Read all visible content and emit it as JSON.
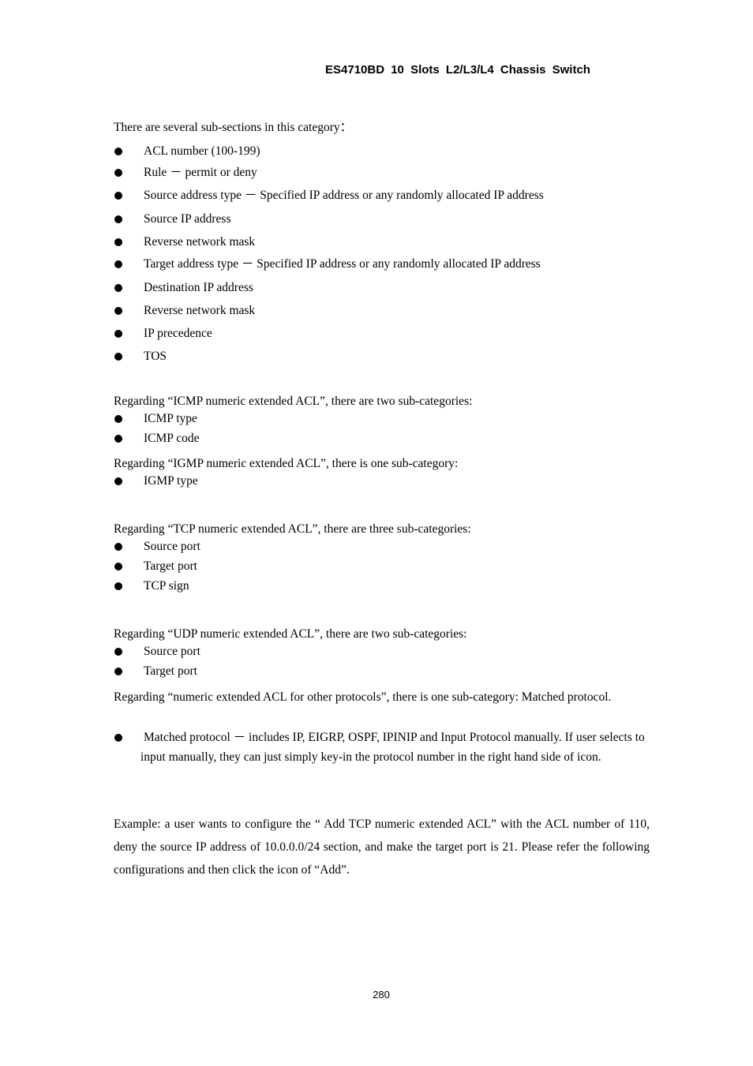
{
  "header": {
    "title": "ES4710BD 10 Slots L2/L3/L4 Chassis Switch"
  },
  "intro": {
    "text": "There are several sub-sections in this category：",
    "items": [
      "ACL number (100-199)",
      "Rule － permit or deny",
      "Source address type － Specified IP address or any randomly allocated IP address",
      "Source IP address",
      "Reverse network mask",
      "Target address type － Specified IP address or any randomly allocated IP address",
      "Destination IP address",
      "Reverse network mask",
      "IP precedence",
      "TOS"
    ]
  },
  "icmp": {
    "text": "Regarding “ICMP numeric extended ACL”, there are two sub-categories:",
    "items": [
      "ICMP type",
      "ICMP code"
    ]
  },
  "igmp": {
    "text": "Regarding “IGMP numeric extended ACL”, there is one sub-category:",
    "items": [
      "IGMP type"
    ]
  },
  "tcp": {
    "text": "Regarding “TCP numeric extended ACL”, there are three sub-categories:",
    "items": [
      "Source port",
      "Target port",
      "TCP sign"
    ]
  },
  "udp": {
    "text": "Regarding “UDP numeric extended ACL”, there are two sub-categories:",
    "items": [
      "Source port",
      "Target port"
    ]
  },
  "other": {
    "text": "Regarding “numeric extended ACL for other protocols”, there is one sub-category: Matched protocol.",
    "item": "Matched protocol － includes IP, EIGRP, OSPF, IPINIP and Input Protocol manually. If user selects to input manually, they can just simply key-in the protocol number in the right hand side of icon."
  },
  "example": {
    "text": "Example: a user wants to configure the “ Add TCP numeric extended ACL” with the ACL number of 110, deny the source IP address of 10.0.0.0/24 section, and make the target port is 21. Please refer the following configurations and then click the icon of “Add”."
  },
  "footer": {
    "page_number": "280"
  }
}
